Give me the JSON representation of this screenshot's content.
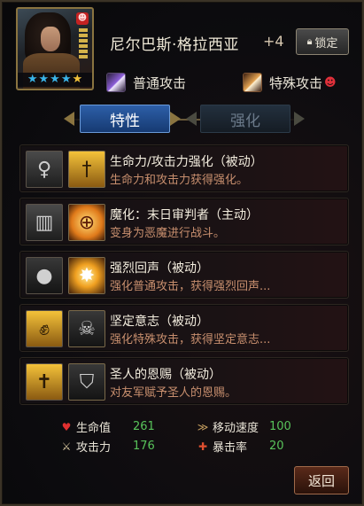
{
  "hero": {
    "name": "尼尔巴斯·格拉西亚",
    "plus_level": "+4",
    "stars_blue": 4,
    "stars_gold": 1,
    "devil_mark": "devil-icon"
  },
  "header": {
    "lock_label": "锁定",
    "normal_attack_label": "普通攻击",
    "special_attack_label": "特殊攻击"
  },
  "tabs": [
    {
      "label": "特性",
      "active": true
    },
    {
      "label": "强化",
      "active": false
    }
  ],
  "skills": [
    {
      "title": "生命力/攻击力强化（被动）",
      "desc": "生命力和攻击力获得强化。",
      "base_icon": "person-icon",
      "skill_icon": "sword-icon"
    },
    {
      "title": "魔化：末日审判者（主动）",
      "desc": "变身为恶魔进行战斗。",
      "base_icon": "gate-icon",
      "skill_icon": "crosshair-icon"
    },
    {
      "title": "强烈回声（被动）",
      "desc": "强化普通攻击，获得强烈回声...",
      "base_icon": "bust-icon",
      "skill_icon": "explosion-icon"
    },
    {
      "title": "坚定意志（被动）",
      "desc": "强化特殊攻击，获得坚定意志...",
      "base_icon": "fist-icon",
      "skill_icon": "mask-icon"
    },
    {
      "title": "圣人的恩赐（被动）",
      "desc": "对友军赋予圣人的恩赐。",
      "base_icon": "tombstone-icon",
      "skill_icon": "shield-icon"
    }
  ],
  "stats": {
    "hp_label": "生命值",
    "hp_value": "261",
    "atk_label": "攻击力",
    "atk_value": "176",
    "speed_label": "移动速度",
    "speed_value": "100",
    "crit_label": "暴击率",
    "crit_value": "20"
  },
  "footer": {
    "return_label": "返回"
  },
  "colors": {
    "active_tab": "#2d5fa8",
    "skill_desc": "#c88f6e",
    "stat_value": "#58c35a"
  }
}
